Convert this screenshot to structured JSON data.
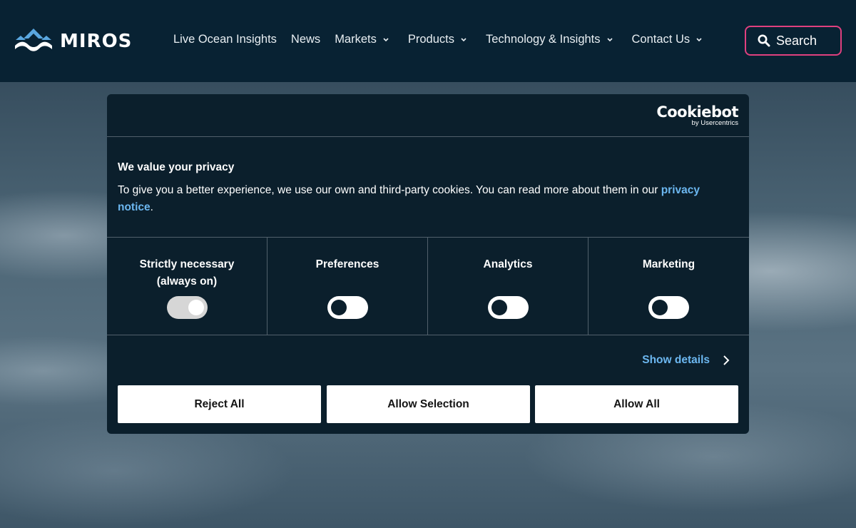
{
  "site": {
    "logo_text": "MIROS"
  },
  "nav": {
    "items": [
      {
        "label": "Live Ocean Insights",
        "has_dropdown": false
      },
      {
        "label": "News",
        "has_dropdown": false
      },
      {
        "label": "Markets",
        "has_dropdown": true
      },
      {
        "label": "Products",
        "has_dropdown": true
      },
      {
        "label": "Technology & Insights",
        "has_dropdown": true
      },
      {
        "label": "Contact Us",
        "has_dropdown": true
      }
    ],
    "search_label": "Search"
  },
  "cookie_dialog": {
    "brand": "Cookiebot",
    "brand_sub": "by Usercentrics",
    "title": "We value your privacy",
    "text_before_link": "To give you a better experience, we use our own and third-party cookies. You can read more about them in our ",
    "link_text": "privacy notice",
    "text_after_link": ".",
    "categories": [
      {
        "line1": "Strictly necessary",
        "line2": "(always on)",
        "enabled": true
      },
      {
        "line1": "Preferences",
        "line2": "",
        "enabled": false
      },
      {
        "line1": "Analytics",
        "line2": "",
        "enabled": false
      },
      {
        "line1": "Marketing",
        "line2": "",
        "enabled": false
      }
    ],
    "show_details_label": "Show details",
    "buttons": {
      "reject": "Reject All",
      "selection": "Allow Selection",
      "allow_all": "Allow All"
    }
  },
  "colors": {
    "header_bg": "#082233",
    "dialog_bg": "#0b1f2c",
    "accent_pink": "#e0407f",
    "link_blue": "#6cb7f0",
    "logo_blue": "#5aa7e0"
  }
}
